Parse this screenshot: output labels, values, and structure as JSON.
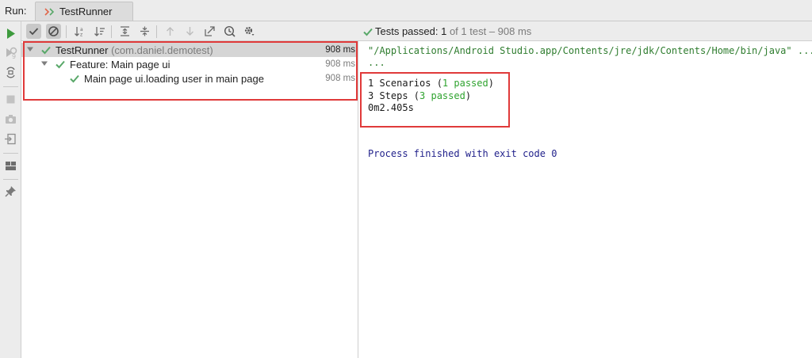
{
  "run_bar": {
    "label": "Run:",
    "tab_title": "TestRunner",
    "tab_close": "×"
  },
  "status": {
    "prefix": "Tests passed: ",
    "passed": "1",
    "rest": " of 1 test – 908 ms"
  },
  "tree": [
    {
      "name": "TestRunner",
      "package": " (com.daniel.demotest)",
      "duration": "908 ms",
      "level": 0,
      "expanded": true,
      "selected": true
    },
    {
      "name": "Feature: Main page ui",
      "package": "",
      "duration": "908 ms",
      "level": 1,
      "expanded": true,
      "selected": false
    },
    {
      "name": "Main page ui.loading user in main page",
      "package": "",
      "duration": "908 ms",
      "level": 2,
      "expanded": false,
      "selected": false
    }
  ],
  "console": {
    "command": "\"/Applications/Android Studio.app/Contents/jre/jdk/Contents/Home/bin/java\" ...",
    "ellipsis": "...",
    "scenarios_prefix": "1 Scenarios (",
    "scenarios_passed": "1 passed",
    "scenarios_suffix": ")",
    "steps_prefix": "3 Steps (",
    "steps_passed": "3 passed",
    "steps_suffix": ")",
    "time": "0m2.405s",
    "exit": "Process finished with exit code 0"
  },
  "colors": {
    "pass_green": "#59a869",
    "highlight_red": "#e03a3a",
    "run_green": "#3d9a3d"
  }
}
